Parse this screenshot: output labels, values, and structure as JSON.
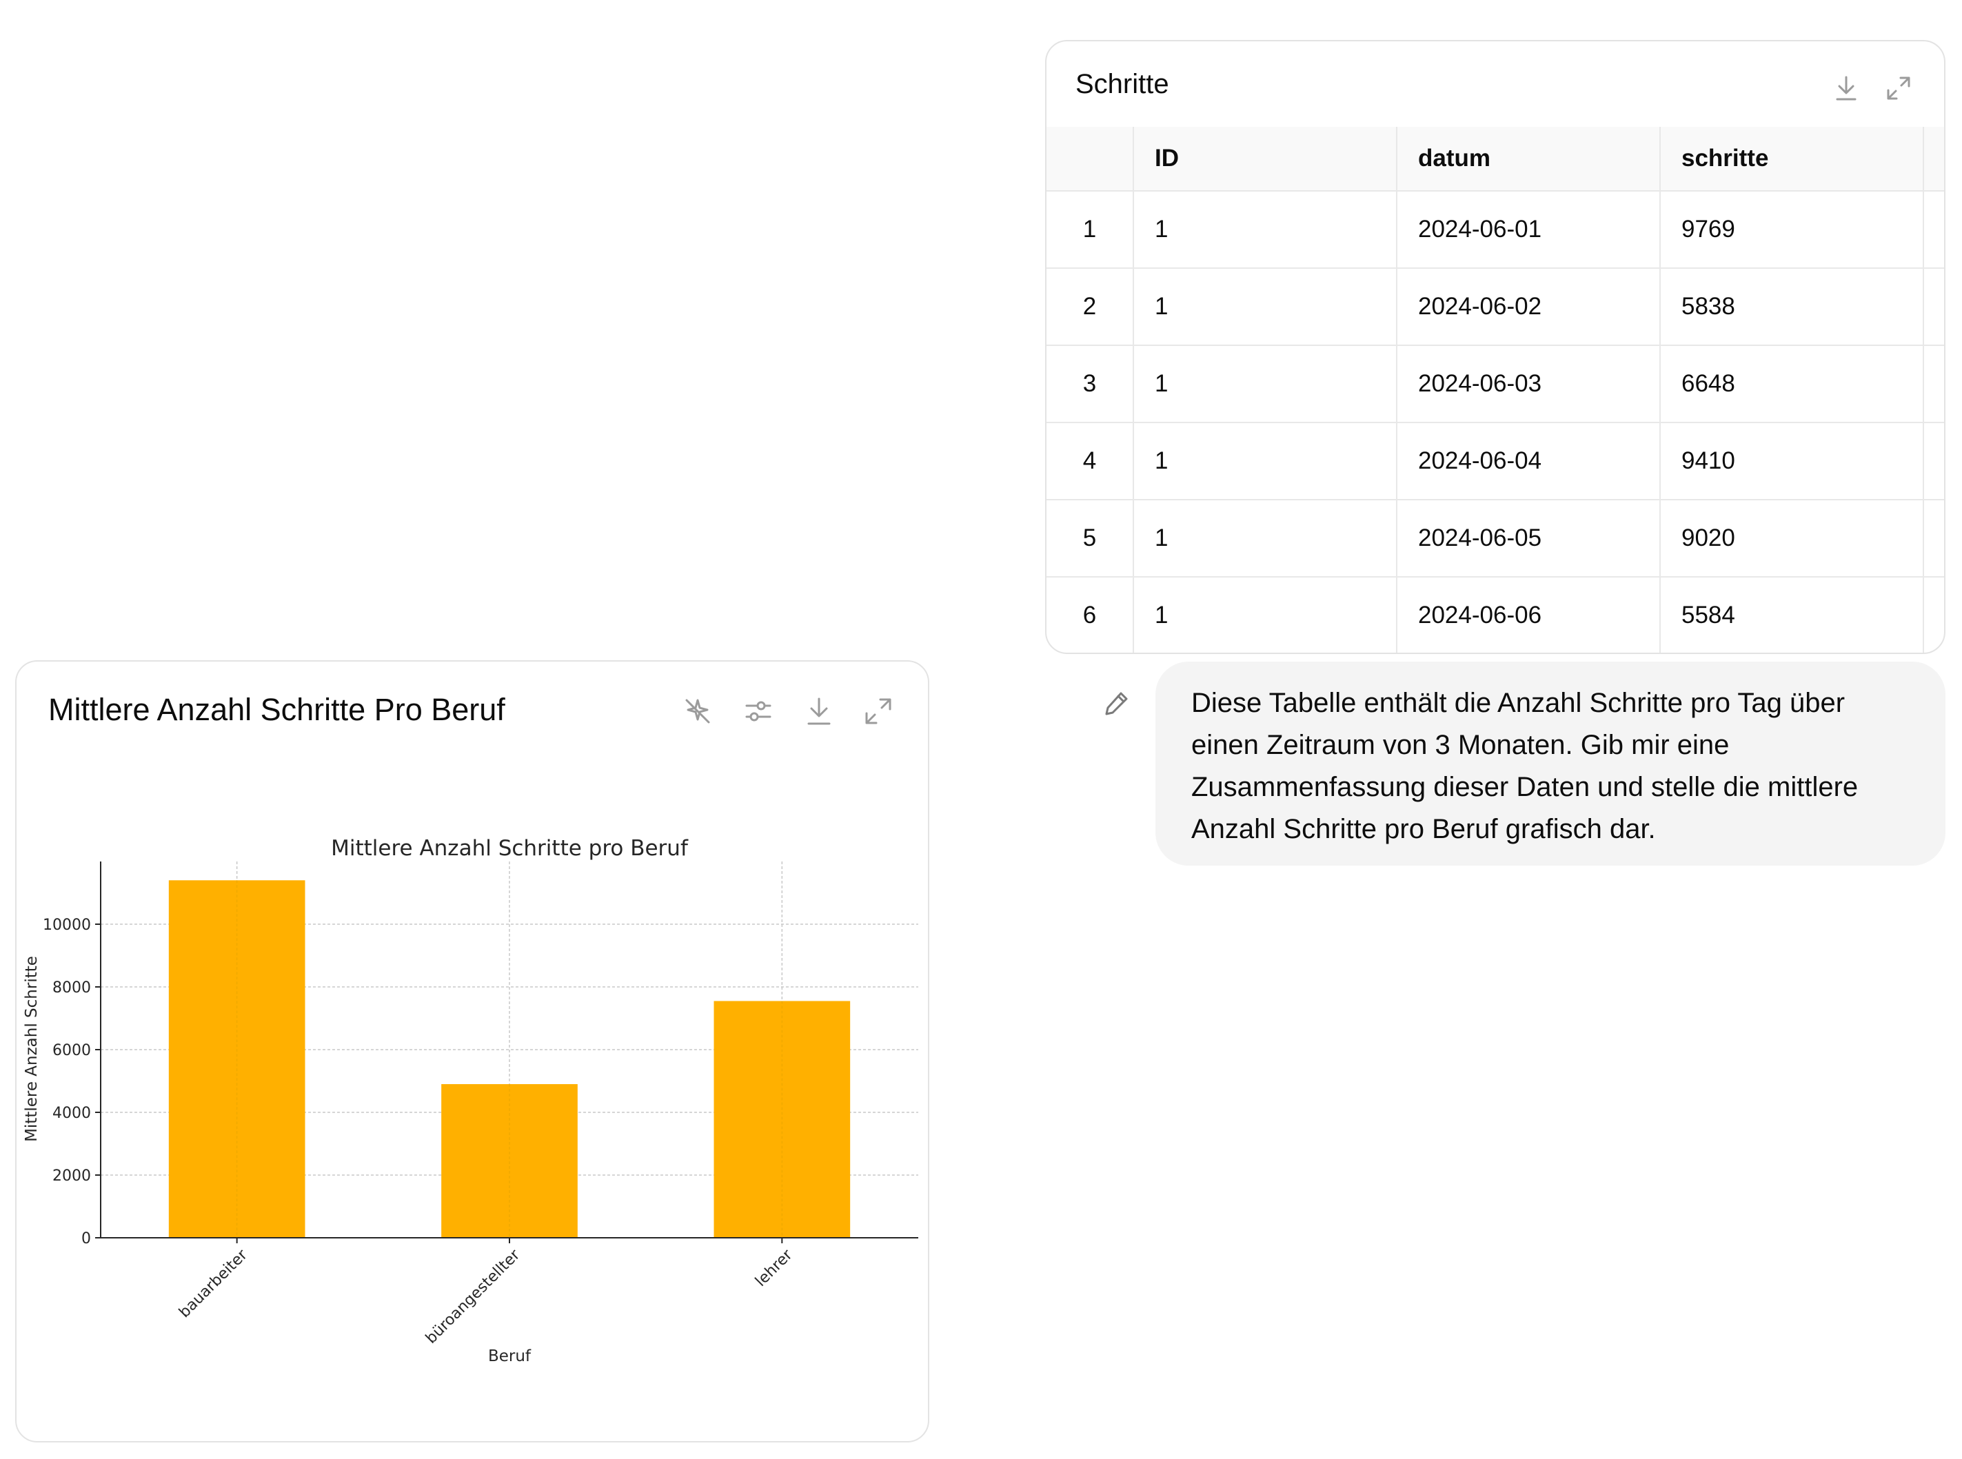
{
  "table_card": {
    "title": "Schritte",
    "columns": [
      "",
      "ID",
      "datum",
      "schritte"
    ],
    "rows": [
      [
        "1",
        "1",
        "2024-06-01",
        "9769"
      ],
      [
        "2",
        "1",
        "2024-06-02",
        "5838"
      ],
      [
        "3",
        "1",
        "2024-06-03",
        "6648"
      ],
      [
        "4",
        "1",
        "2024-06-04",
        "9410"
      ],
      [
        "5",
        "1",
        "2024-06-05",
        "9020"
      ],
      [
        "6",
        "1",
        "2024-06-06",
        "5584"
      ]
    ],
    "icons": [
      "download-icon",
      "expand-icon"
    ]
  },
  "chart_card": {
    "title": "Mittlere Anzahl Schritte Pro Beruf",
    "icons": [
      "ai-sparkle-off-icon",
      "sliders-icon",
      "download-icon",
      "expand-icon"
    ]
  },
  "chart_data": {
    "type": "bar",
    "title": "Mittlere Anzahl Schritte pro Beruf",
    "xlabel": "Beruf",
    "ylabel": "Mittlere Anzahl Schritte",
    "categories": [
      "bauarbeiter",
      "büroangestellter",
      "lehrer"
    ],
    "values": [
      11400,
      4900,
      7550
    ],
    "ylim": [
      0,
      12000
    ],
    "yticks": [
      0,
      2000,
      4000,
      6000,
      8000,
      10000
    ],
    "bar_color": "#ffb000",
    "grid": true,
    "legend": "none"
  },
  "message": {
    "text": "Diese Tabelle enthält die Anzahl Schritte pro Tag über einen Zeitraum von 3 Monaten. Gib mir eine Zusammenfassung dieser Daten und stelle die mittlere Anzahl Schritte pro Beruf grafisch dar.",
    "edit_icon": "pencil-icon"
  }
}
